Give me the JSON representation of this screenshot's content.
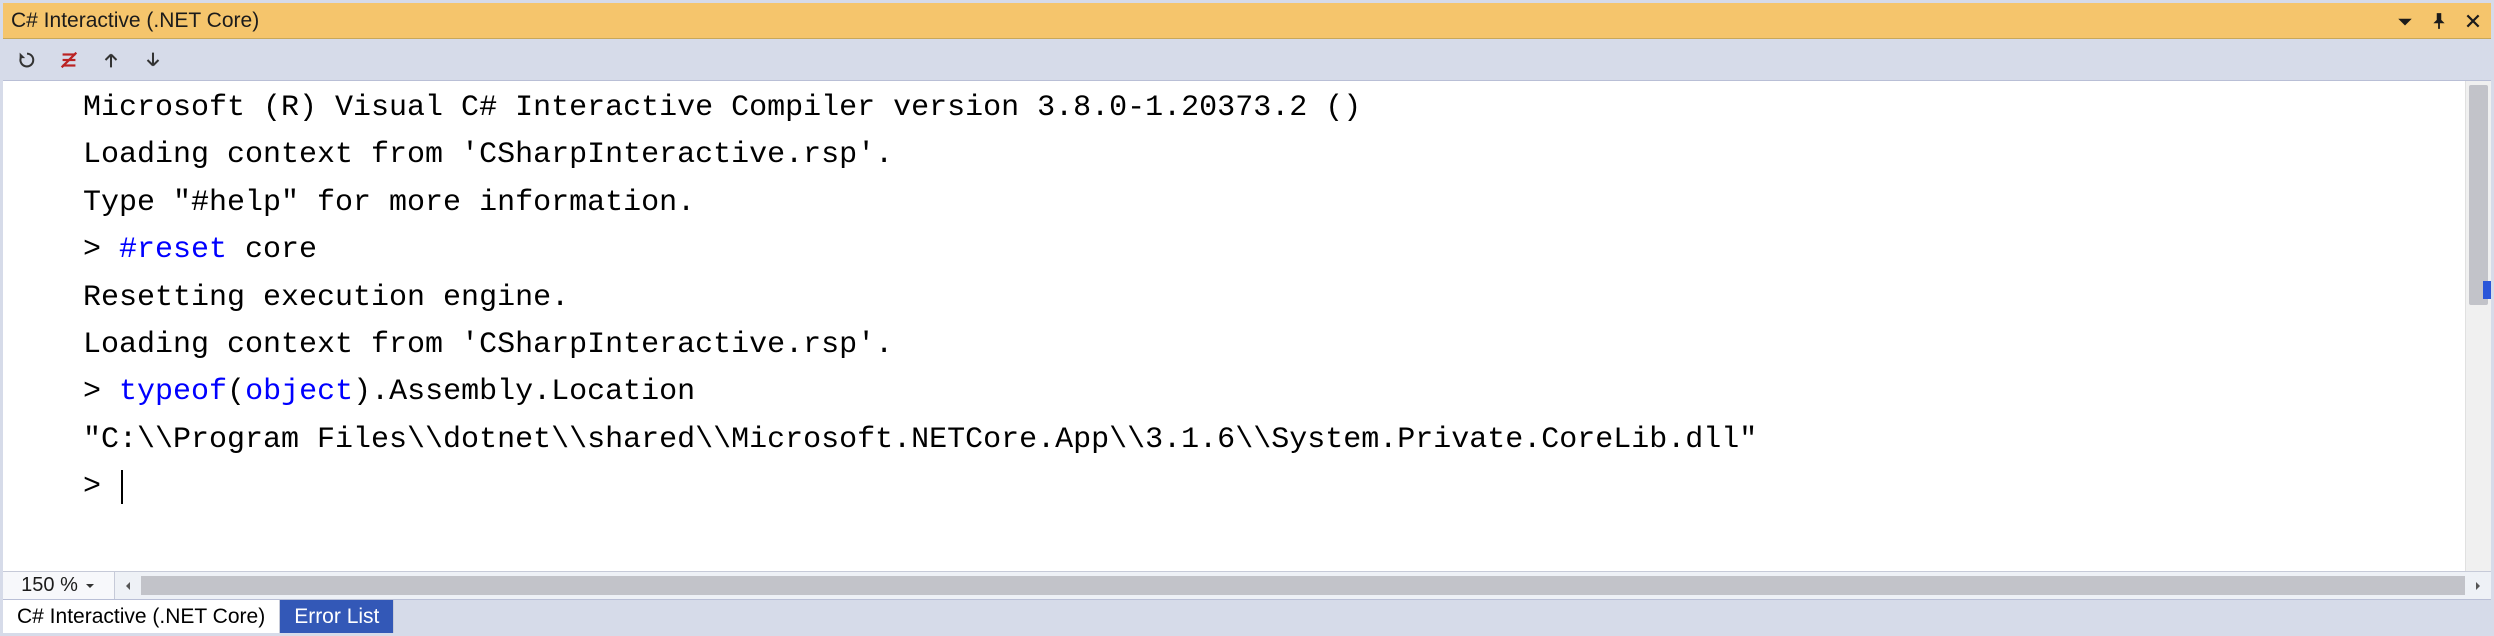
{
  "window": {
    "title": "C# Interactive (.NET Core)"
  },
  "toolbar": {
    "reset_tooltip": "Reset",
    "clear_tooltip": "Clear Screen",
    "history_prev_tooltip": "History Previous",
    "history_next_tooltip": "History Next"
  },
  "console": {
    "lines": [
      {
        "segments": [
          {
            "t": "Microsoft (R) Visual C# Interactive Compiler version 3.8.0-1.20373.2 ()"
          }
        ]
      },
      {
        "segments": [
          {
            "t": "Loading context from 'CSharpInteractive.rsp'."
          }
        ]
      },
      {
        "segments": [
          {
            "t": "Type \"#help\" for more information."
          }
        ]
      },
      {
        "segments": [
          {
            "t": "> "
          },
          {
            "t": "#reset",
            "cls": "kw"
          },
          {
            "t": " core"
          }
        ]
      },
      {
        "segments": [
          {
            "t": "Resetting execution engine."
          }
        ]
      },
      {
        "segments": [
          {
            "t": "Loading context from 'CSharpInteractive.rsp'."
          }
        ]
      },
      {
        "segments": [
          {
            "t": "> "
          },
          {
            "t": "typeof",
            "cls": "kw"
          },
          {
            "t": "("
          },
          {
            "t": "object",
            "cls": "kw"
          },
          {
            "t": ").Assembly.Location"
          }
        ]
      },
      {
        "segments": [
          {
            "t": "\"C:\\\\Program Files\\\\dotnet\\\\shared\\\\Microsoft.NETCore.App\\\\3.1.6\\\\System.Private.CoreLib.dll\""
          }
        ]
      },
      {
        "segments": [
          {
            "t": "> "
          }
        ],
        "cursor": true
      }
    ]
  },
  "zoom": {
    "level": "150 %"
  },
  "tabs": [
    {
      "label": "C# Interactive (.NET Core)",
      "active": true
    },
    {
      "label": "Error List",
      "active": false
    }
  ]
}
